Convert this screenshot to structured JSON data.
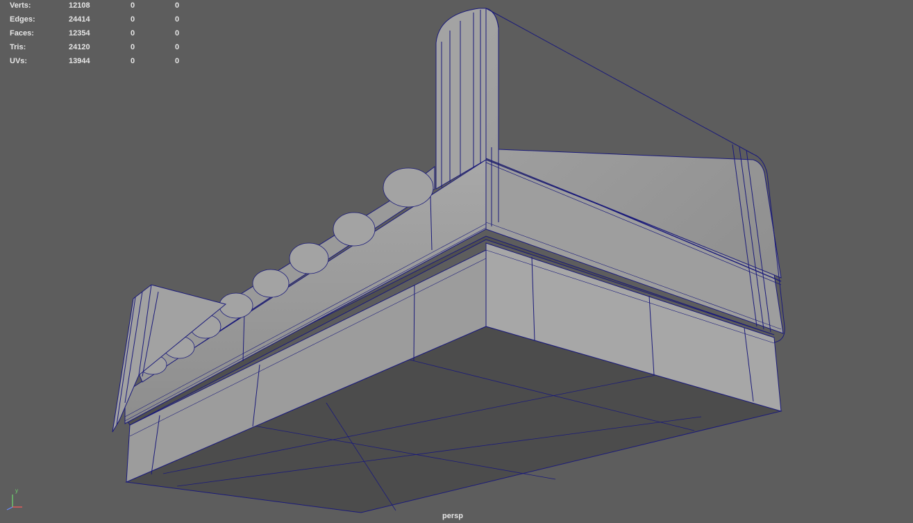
{
  "hud": {
    "rows": [
      {
        "label": "Verts:",
        "v1": "12108",
        "v2": "0",
        "v3": "0"
      },
      {
        "label": "Edges:",
        "v1": "24414",
        "v2": "0",
        "v3": "0"
      },
      {
        "label": "Faces:",
        "v1": "12354",
        "v2": "0",
        "v3": "0"
      },
      {
        "label": "Tris:",
        "v1": "24120",
        "v2": "0",
        "v3": "0"
      },
      {
        "label": "UVs:",
        "v1": "13944",
        "v2": "0",
        "v3": "0"
      }
    ]
  },
  "camera": "persp",
  "axis": {
    "y": "y",
    "x": "x"
  },
  "colors": {
    "background": "#5d5d5d",
    "wireframe": "#1a1a7a",
    "face_light": "#a9a9a9",
    "face_mid": "#8e8e8e",
    "face_dark": "#4c4c4c",
    "hud_text": "#e6e6e6"
  }
}
